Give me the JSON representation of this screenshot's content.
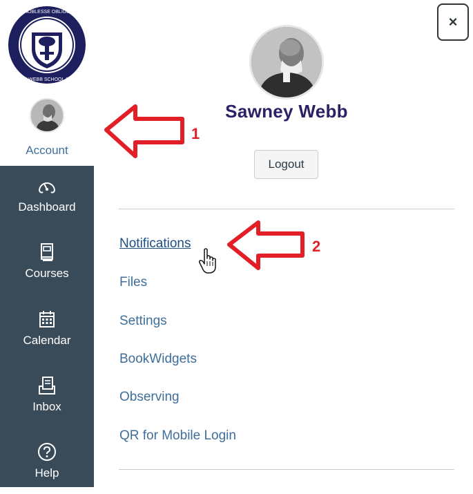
{
  "school_logo": {
    "alt_text": "NOBLESSE OBLIGE THE WEBB SCHOOL 1920"
  },
  "global_nav": {
    "account_label": "Account",
    "items": [
      {
        "label": "Dashboard",
        "icon": "dashboard-icon"
      },
      {
        "label": "Courses",
        "icon": "courses-icon"
      },
      {
        "label": "Calendar",
        "icon": "calendar-icon"
      },
      {
        "label": "Inbox",
        "icon": "inbox-icon"
      },
      {
        "label": "Help",
        "icon": "help-icon"
      }
    ]
  },
  "account_tray": {
    "close_label": "×",
    "user_name": "Sawney Webb",
    "logout_label": "Logout",
    "links": [
      {
        "label": "Notifications"
      },
      {
        "label": "Files"
      },
      {
        "label": "Settings"
      },
      {
        "label": "BookWidgets"
      },
      {
        "label": "Observing"
      },
      {
        "label": "QR for Mobile Login"
      }
    ]
  },
  "annotations": {
    "step_1": "1",
    "step_2": "2",
    "color": "#e21f26"
  },
  "colors": {
    "nav_background": "#394b58",
    "link": "#3f6e9b",
    "user_name": "#2b2165"
  }
}
